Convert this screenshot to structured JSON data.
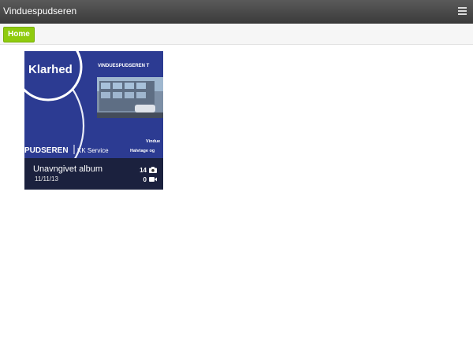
{
  "header": {
    "title": "Vinduespudseren",
    "menu_icon": "hamburger-icon"
  },
  "nav": {
    "home_label": "Home"
  },
  "album": {
    "title": "Unavngivet album",
    "date": "11/11/13",
    "photo_count": "14",
    "video_count": "0",
    "photo_icon": "camera-icon",
    "video_icon": "video-camera-icon",
    "cover": {
      "badge_text": "Klarhed",
      "banner_text": "VINDUESPUDSEREN T",
      "brand_text": "PUDSEREN",
      "service_text": "KK Service",
      "right_line1": "Vindue",
      "right_line2": "Halvtage og"
    }
  }
}
